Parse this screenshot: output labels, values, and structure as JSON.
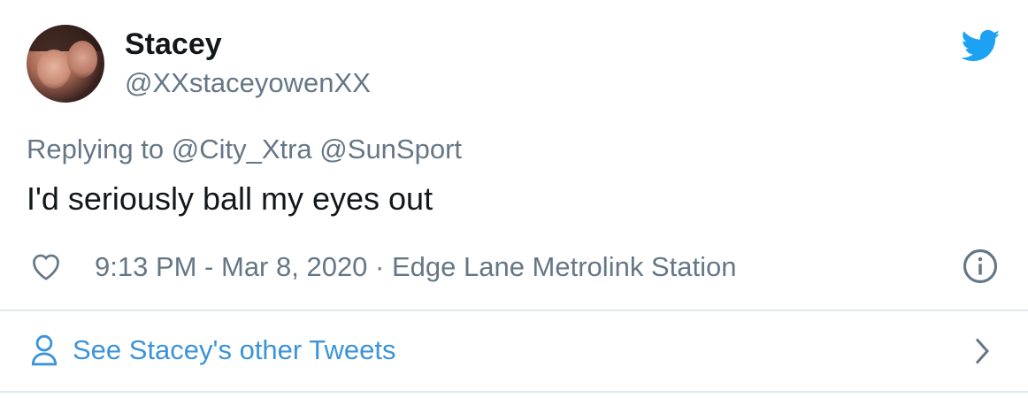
{
  "tweet": {
    "display_name": "Stacey",
    "handle": "@XXstaceyowenXX",
    "reply_prefix": "Replying to",
    "reply_mentions": [
      "@City_Xtra",
      "@SunSport"
    ],
    "text": "I'd seriously ball my eyes out",
    "meta": "9:13 PM - Mar 8, 2020 · Edge Lane Metrolink Station",
    "other_tweets_label": "See Stacey's other Tweets"
  },
  "icons": {
    "brand": "twitter-bird-icon",
    "like": "heart-icon",
    "info": "info-icon",
    "profile": "person-icon",
    "chevron": "chevron-right-icon"
  },
  "colors": {
    "brand_blue": "#1da1f2",
    "link_blue": "#3b94d9",
    "secondary_text": "#657786",
    "primary_text": "#14171a",
    "divider": "#e1e8ed"
  }
}
